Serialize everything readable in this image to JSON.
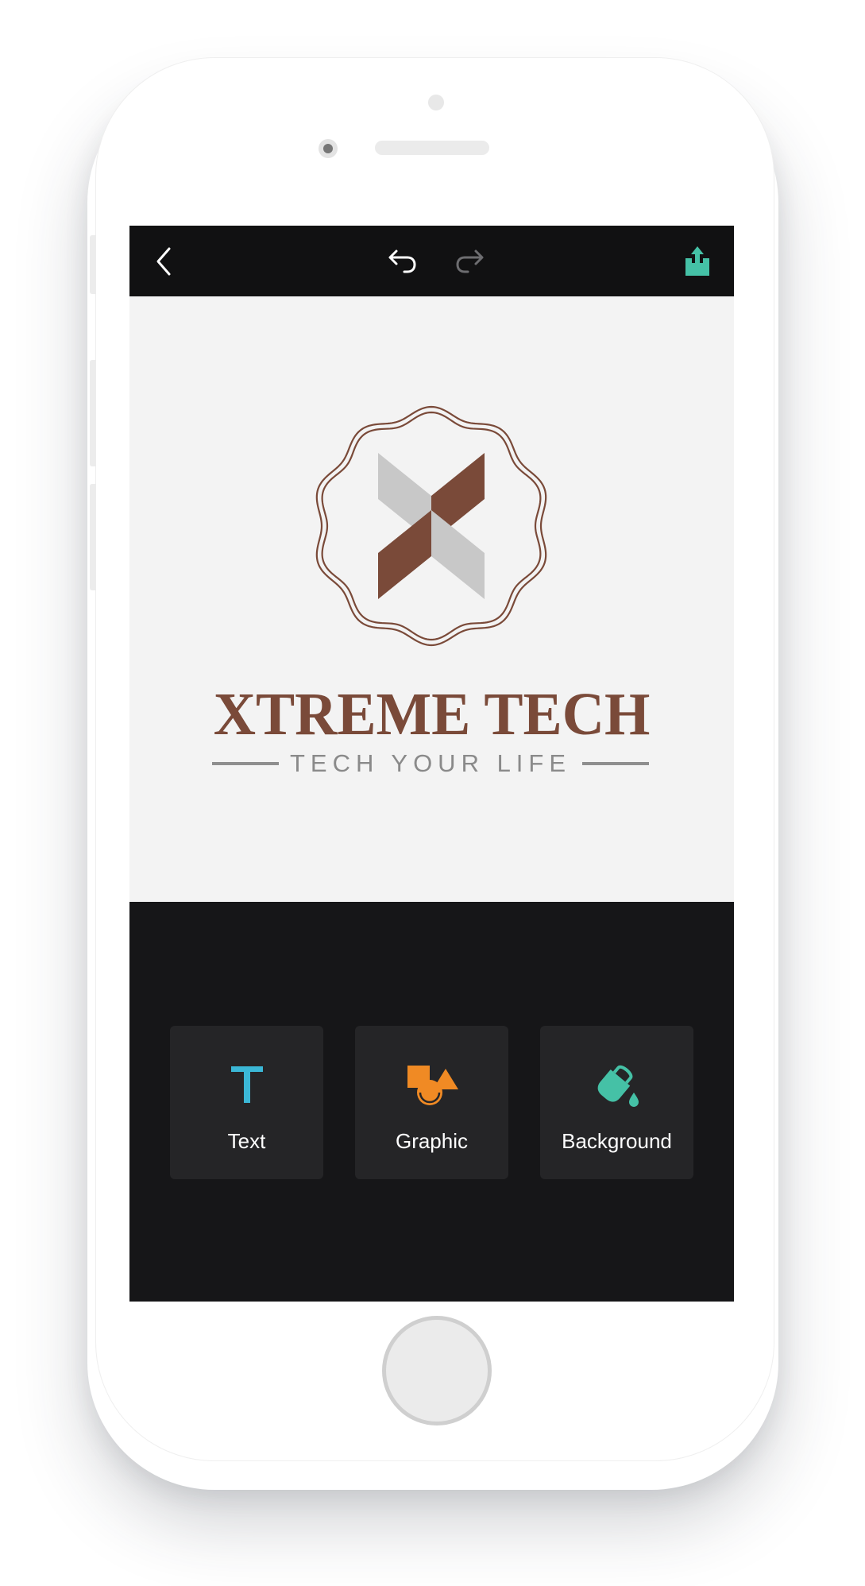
{
  "colors": {
    "brand_brown": "#7a4a39",
    "text_tool_accent": "#3bb7d6",
    "graphic_tool_accent": "#f08a24",
    "background_tool_accent": "#45c1a6",
    "share_accent": "#45c1a6",
    "toolbar_bg": "#111112",
    "panel_bg": "#161618",
    "tool_bg": "#252527",
    "canvas_bg": "#f3f3f3"
  },
  "toolbar": {
    "back_icon": "chevron-left-icon",
    "undo_icon": "undo-icon",
    "redo_icon": "redo-icon",
    "redo_enabled": false,
    "share_icon": "share-icon"
  },
  "canvas": {
    "logo": {
      "brand_name": "XTREME TECH",
      "tagline": "TECH YOUR LIFE",
      "badge_icon": "wavy-x-badge-icon"
    }
  },
  "tools": [
    {
      "label": "Text",
      "icon": "text-t-icon"
    },
    {
      "label": "Graphic",
      "icon": "shapes-icon"
    },
    {
      "label": "Background",
      "icon": "paint-bucket-icon"
    }
  ]
}
